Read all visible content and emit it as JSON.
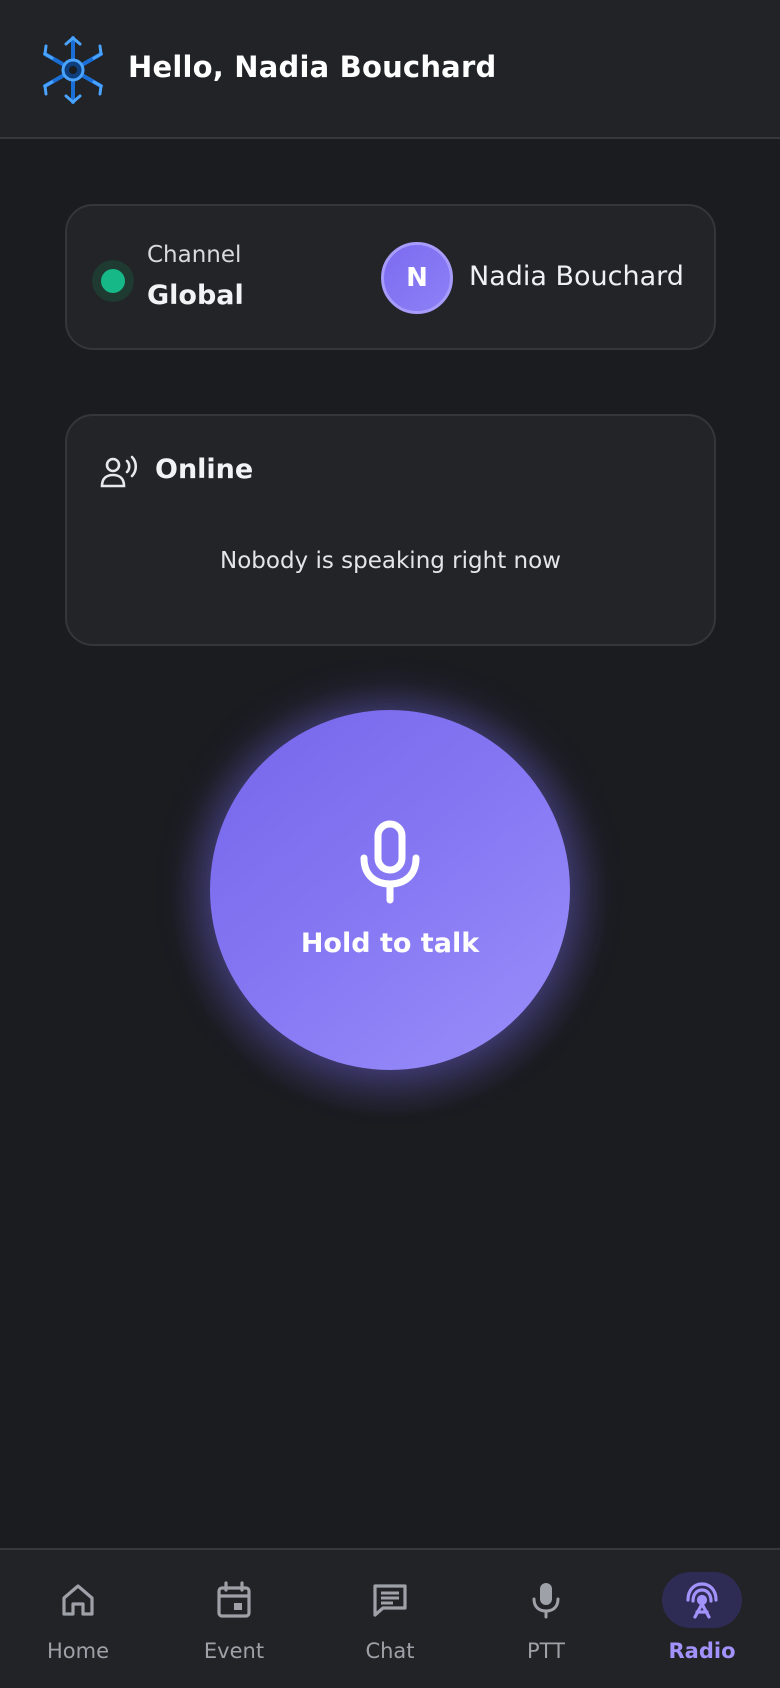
{
  "header": {
    "greeting": "Hello, Nadia Bouchard",
    "logo_icon": "snowflake-logo-icon"
  },
  "channel_card": {
    "label": "Channel",
    "name": "Global",
    "status_color": "#16b887",
    "avatar_initial": "N",
    "user_name": "Nadia Bouchard"
  },
  "online_card": {
    "icon": "speaking-person-icon",
    "title": "Online",
    "empty_message": "Nobody is speaking right now"
  },
  "ptt": {
    "icon": "microphone-icon",
    "label": "Hold to talk",
    "accent": "#7c6cf0"
  },
  "nav": {
    "items": [
      {
        "label": "Home",
        "icon": "home-icon",
        "active": false
      },
      {
        "label": "Event",
        "icon": "calendar-icon",
        "active": false
      },
      {
        "label": "Chat",
        "icon": "chat-icon",
        "active": false
      },
      {
        "label": "PTT",
        "icon": "microphone-icon",
        "active": false
      },
      {
        "label": "Radio",
        "icon": "radio-tower-icon",
        "active": true
      }
    ]
  }
}
